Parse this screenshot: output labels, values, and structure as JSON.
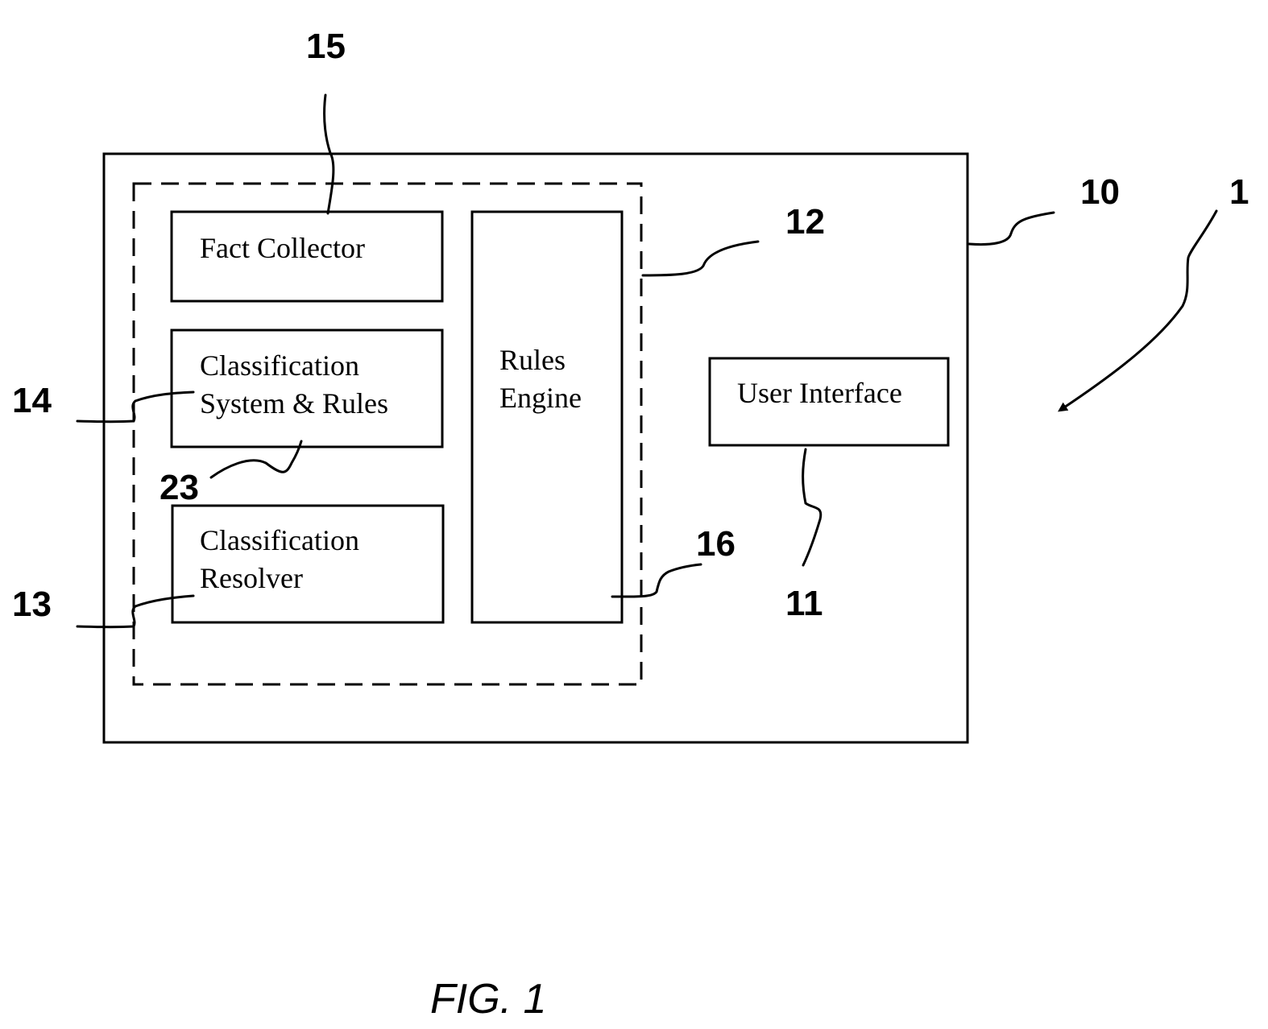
{
  "figure": {
    "caption": "FIG. 1",
    "system_ref": "1"
  },
  "outer_box": {
    "ref": "10"
  },
  "dashed_group": {
    "ref": "12"
  },
  "components": {
    "fact_collector": {
      "label": "Fact Collector",
      "ref": "15"
    },
    "classification_system": {
      "label_line1": "Classification",
      "label_line2": "System & Rules",
      "ref": "14",
      "sub_ref": "23"
    },
    "classification_resolver": {
      "label_line1": "Classification",
      "label_line2": "Resolver",
      "ref": "13"
    },
    "rules_engine": {
      "label_line1": "Rules",
      "label_line2": "Engine",
      "ref": "16"
    },
    "user_interface": {
      "label": "User Interface",
      "ref": "11"
    }
  },
  "colors": {
    "stroke": "#000000",
    "background": "#ffffff"
  }
}
